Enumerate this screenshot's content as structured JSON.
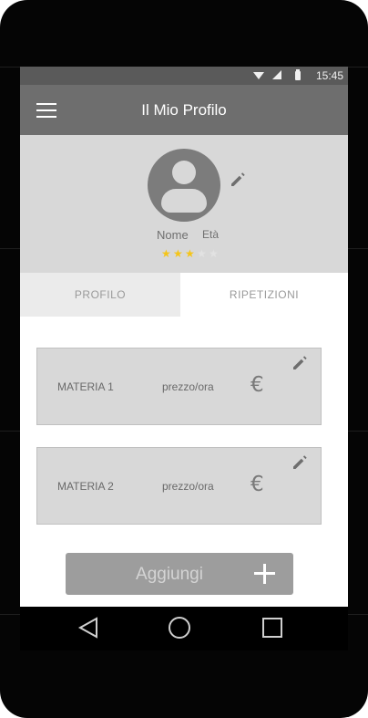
{
  "status_bar": {
    "time": "15:45"
  },
  "app_bar": {
    "title": "Il Mio Profilo"
  },
  "profile": {
    "name_label": "Nome",
    "age_label": "Età",
    "rating": 3,
    "rating_max": 5
  },
  "tabs": [
    {
      "label": "PROFILO"
    },
    {
      "label": "RIPETIZIONI"
    }
  ],
  "subjects": [
    {
      "name": "MATERIA 1",
      "price_label": "prezzo/ora",
      "currency_symbol": "€"
    },
    {
      "name": "MATERIA 2",
      "price_label": "prezzo/ora",
      "currency_symbol": "€"
    }
  ],
  "add_button": {
    "label": "Aggiungi"
  },
  "colors": {
    "app_bar": "#6e6e6e",
    "status_bar": "#5a5a5a",
    "star_filled": "#f5c518",
    "star_empty": "#e2e2e2",
    "card_background": "#d8d8d8"
  },
  "icons": [
    "menu-icon",
    "avatar-icon",
    "pencil-icon",
    "star-icon",
    "euro-icon",
    "plus-icon",
    "back-icon",
    "home-icon",
    "recents-icon",
    "wifi-icon",
    "signal-icon",
    "battery-icon"
  ]
}
